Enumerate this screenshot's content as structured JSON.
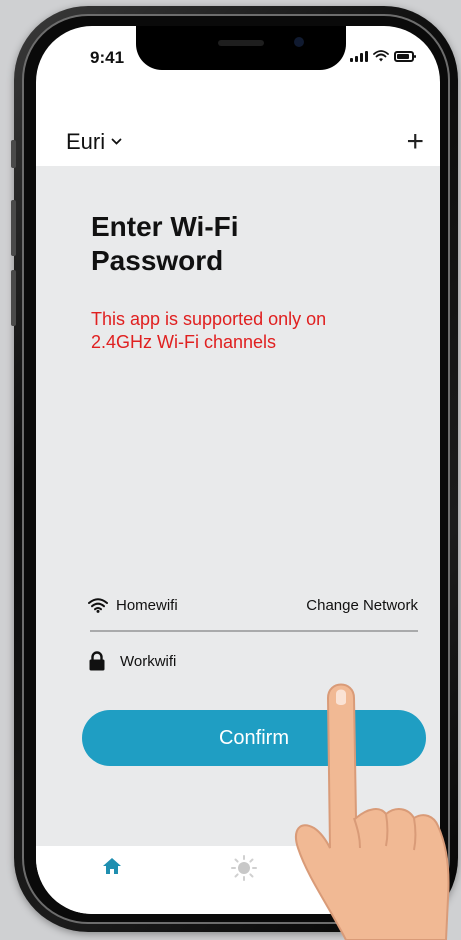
{
  "status": {
    "time": "9:41"
  },
  "header": {
    "home_name": "Euri",
    "add_icon": "+"
  },
  "main": {
    "title_line1": "Enter Wi-Fi",
    "title_line2": "Password",
    "notice_line1": "This app is supported only on",
    "notice_line2": "2.4GHz Wi-Fi channels",
    "network": {
      "name": "Homewifi",
      "change_label": "Change Network"
    },
    "password": {
      "value": "Workwifi"
    },
    "confirm_label": "Confirm"
  },
  "tabs": [
    {
      "icon": "home-icon",
      "active": true
    },
    {
      "icon": "scenes-icon",
      "active": false
    }
  ],
  "colors": {
    "accent": "#1f9ec3",
    "warning": "#e02020",
    "content_bg": "#e9eaeb"
  }
}
